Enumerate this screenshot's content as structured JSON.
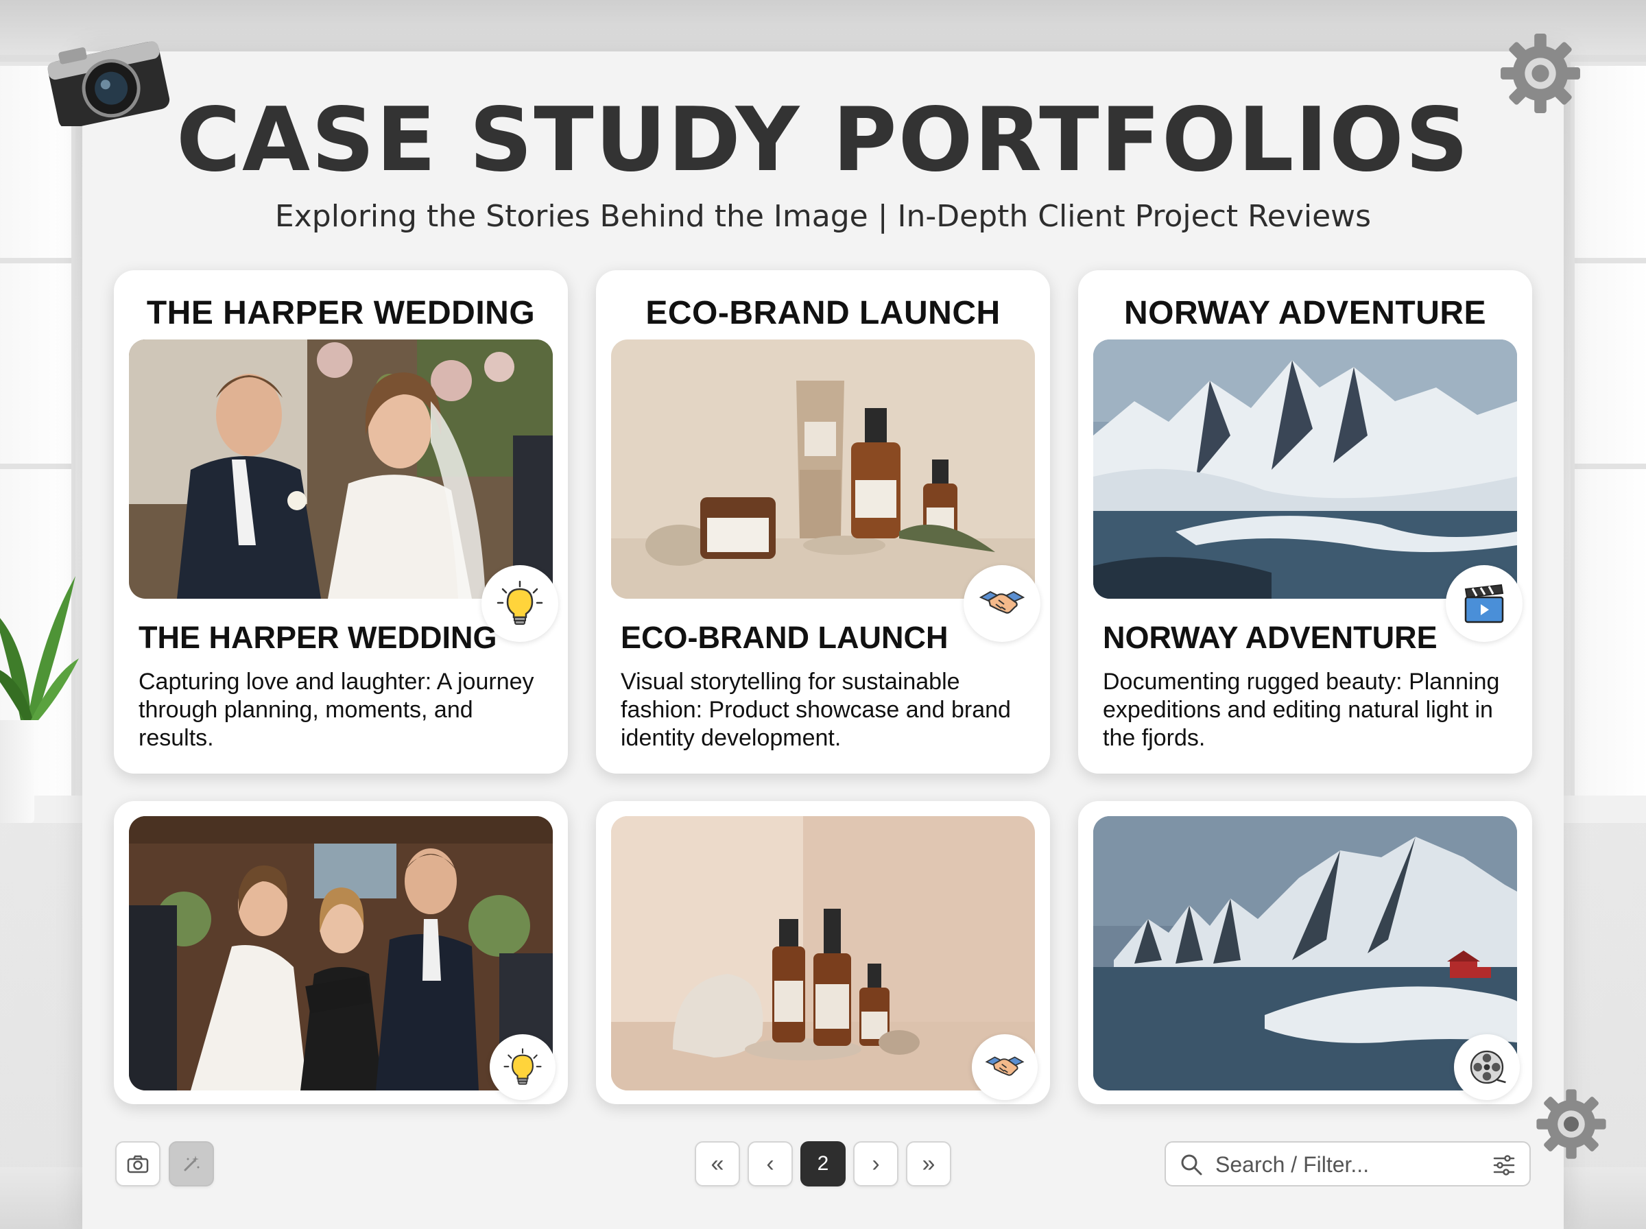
{
  "page": {
    "title": "CASE STUDY PORTFOLIOS",
    "subtitle": "Exploring the Stories Behind the Image | In-Depth Client Project Reviews"
  },
  "cards": [
    {
      "title": "THE HARPER WEDDING",
      "heading": "THE HARPER WEDDING",
      "description": "Capturing love and laughter: A journey through planning, moments, and results.",
      "badge_icon": "lightbulb-icon"
    },
    {
      "title": "ECO-BRAND LAUNCH",
      "heading": "ECO-BRAND LAUNCH",
      "description": "Visual storytelling for sustainable fashion: Product showcase and brand identity development.",
      "badge_icon": "handshake-icon"
    },
    {
      "title": "NORWAY ADVENTURE",
      "heading": "NORWAY ADVENTURE",
      "description": "Documenting rugged beauty: Planning expeditions and editing natural light in the fjords.",
      "badge_icon": "clapperboard-icon"
    }
  ],
  "second_row": [
    {
      "badge_icon": "lightbulb-icon"
    },
    {
      "badge_icon": "handshake-icon"
    },
    {
      "badge_icon": "film-reel-icon"
    }
  ],
  "toolbar": {
    "camera_button_icon": "camera-icon",
    "magic_button_icon": "magic-wand-icon"
  },
  "pagination": {
    "first": "«",
    "prev": "‹",
    "current": "2",
    "next": "›",
    "last": "»"
  },
  "search": {
    "placeholder": "Search / Filter...",
    "value": ""
  },
  "colors": {
    "title": "#333333",
    "active_page": "#2e2e2e",
    "card_bg": "#ffffff"
  }
}
